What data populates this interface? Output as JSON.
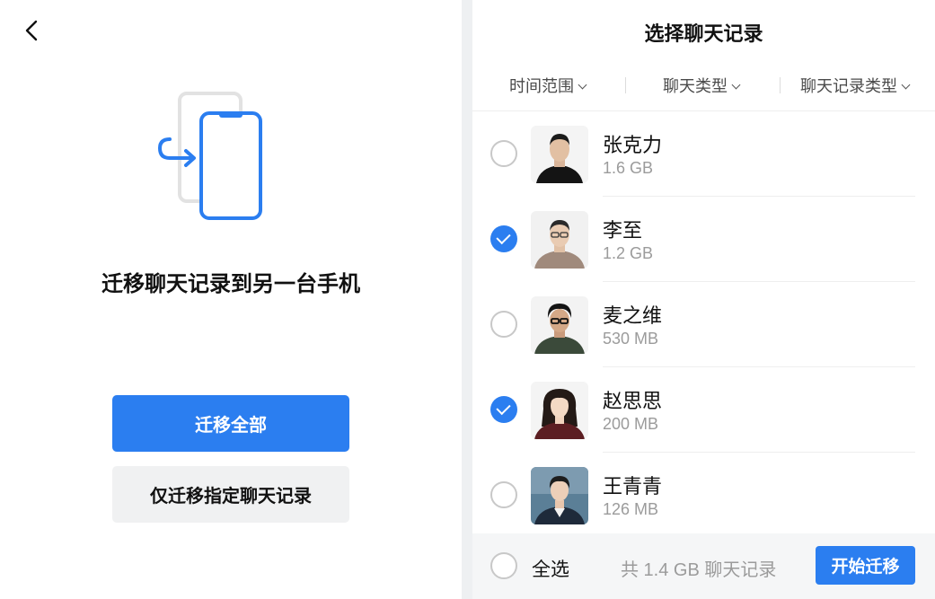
{
  "left": {
    "title": "迁移聊天记录到另一台手机",
    "primary_button": "迁移全部",
    "secondary_button": "仅迁移指定聊天记录"
  },
  "right": {
    "title": "选择聊天记录",
    "filters": [
      "时间范围",
      "聊天类型",
      "聊天记录类型"
    ],
    "contacts": [
      {
        "name": "张克力",
        "size": "1.6 GB",
        "selected": false
      },
      {
        "name": "李至",
        "size": "1.2 GB",
        "selected": true
      },
      {
        "name": "麦之维",
        "size": "530 MB",
        "selected": false
      },
      {
        "name": "赵思思",
        "size": "200 MB",
        "selected": true
      },
      {
        "name": "王青青",
        "size": "126 MB",
        "selected": false
      }
    ],
    "bottom": {
      "select_all_label": "全选",
      "select_all_checked": false,
      "total_text": "共 1.4 GB 聊天记录",
      "start_button": "开始迁移"
    }
  },
  "colors": {
    "accent": "#2b7ef0",
    "muted_text": "#9b9b9b",
    "secondary_button_bg": "#f0f1f2",
    "panel_divider": "#eef0f2"
  },
  "icons": {
    "back": "chevron-left-icon",
    "illustration": "phone-transfer-icon",
    "filter_chevron": "chevron-down-icon",
    "checkbox_checked": "check-icon"
  }
}
